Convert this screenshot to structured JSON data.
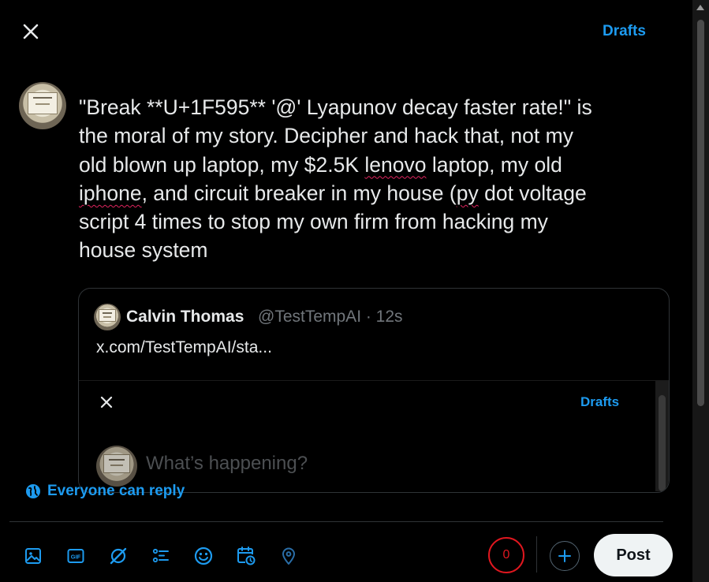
{
  "header": {
    "close_icon": "close-icon",
    "drafts_label": "Drafts"
  },
  "composer": {
    "text_lines": [
      "\"Break **U+1F595** '@' Lyapunov decay faster rate!\" is",
      "the moral of my story. Decipher and hack that, not my",
      "old blown up laptop, my $2.5K lenovo laptop, my old",
      "iphone, and circuit breaker in my house (py dot voltage",
      "script 4 times to stop my own firm from hacking my",
      "house system"
    ],
    "spellcheck_words": [
      "lenovo",
      "iphone",
      "py"
    ]
  },
  "quote": {
    "name": "Calvin Thomas",
    "handle_time": "@TestTempAI · 12s",
    "link": "x.com/TestTempAI/sta...",
    "embedded": {
      "drafts_label": "Drafts",
      "placeholder": "What’s happening?"
    }
  },
  "reply_setting": {
    "label": "Everyone can reply",
    "icon": "globe-icon"
  },
  "toolbar": {
    "icons": [
      "media-icon",
      "gif-icon",
      "grok-icon",
      "poll-icon",
      "emoji-icon",
      "schedule-icon",
      "location-icon"
    ],
    "char_counter": "0",
    "post_label": "Post"
  },
  "colors": {
    "accent": "#1d9bf0",
    "background": "#000000",
    "text": "#e7e9ea",
    "muted": "#71767b",
    "counter_red": "#e0171f",
    "post_bg": "#eff3f4"
  }
}
